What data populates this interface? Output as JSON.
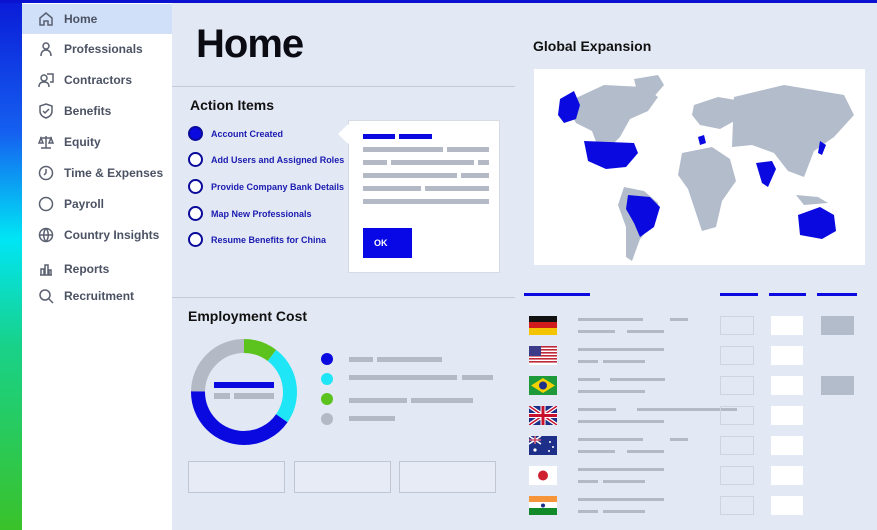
{
  "sidebar": {
    "items": [
      {
        "label": "Home",
        "icon": "home-icon",
        "active": true
      },
      {
        "label": "Professionals",
        "icon": "person-icon"
      },
      {
        "label": "Contractors",
        "icon": "contractors-icon"
      },
      {
        "label": "Benefits",
        "icon": "shield-icon"
      },
      {
        "label": "Equity",
        "icon": "scale-icon"
      },
      {
        "label": "Time & Expenses",
        "icon": "clock-icon"
      },
      {
        "label": "Payroll",
        "icon": "circle-icon"
      },
      {
        "label": "Country Insights",
        "icon": "globe-icon"
      },
      {
        "label": "Reports",
        "icon": "reports-icon"
      },
      {
        "label": "Recruitment",
        "icon": "search-icon"
      }
    ]
  },
  "page": {
    "title": "Home"
  },
  "action_items": {
    "title": "Action Items",
    "items": [
      {
        "label": "Account Created",
        "done": true
      },
      {
        "label": "Add Users and Assigned Roles",
        "done": false
      },
      {
        "label": "Provide Company Bank Details",
        "done": false
      },
      {
        "label": "Map New Professionals",
        "done": false
      },
      {
        "label": "Resume Benefits for China",
        "done": false
      }
    ],
    "popup": {
      "ok_label": "OK"
    }
  },
  "employment_cost": {
    "title": "Employment Cost",
    "legend_colors": [
      "#0a0ae0",
      "#1ee6f6",
      "#5cc21e",
      "#b3b9c5"
    ]
  },
  "global_expansion": {
    "title": "Global Expansion",
    "highlighted": [
      "Alaska",
      "USA",
      "Brazil",
      "UK",
      "India",
      "Japan",
      "Australia"
    ]
  },
  "table": {
    "flags": [
      "germany-flag",
      "usa-flag",
      "brazil-flag",
      "uk-flag",
      "australia-flag",
      "japan-flag",
      "india-flag"
    ]
  },
  "colors": {
    "accent": "#0a0ae0",
    "background": "#e3e9f4"
  }
}
